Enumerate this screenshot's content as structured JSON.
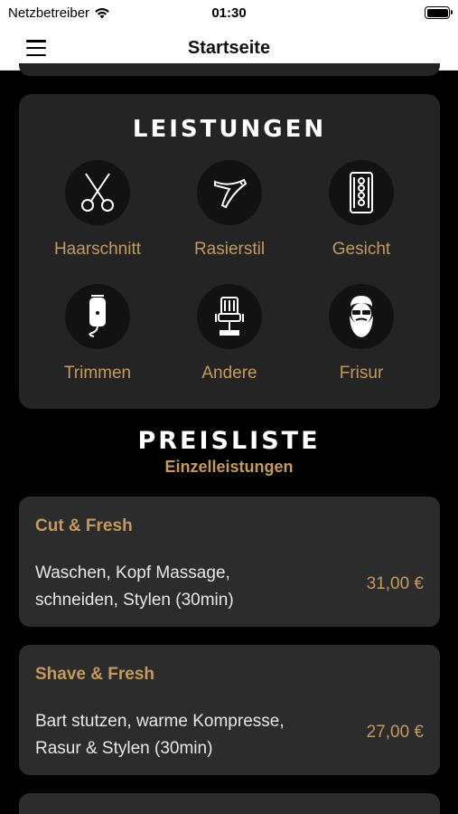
{
  "status_bar": {
    "carrier": "Netzbetreiber",
    "time": "01:30"
  },
  "nav": {
    "title": "Startseite"
  },
  "services": {
    "title": "LEISTUNGEN",
    "items": [
      {
        "label": "Haarschnitt",
        "icon": "scissors-icon"
      },
      {
        "label": "Rasierstil",
        "icon": "straight-razor-icon"
      },
      {
        "label": "Gesicht",
        "icon": "razor-blade-icon"
      },
      {
        "label": "Trimmen",
        "icon": "hair-clipper-icon"
      },
      {
        "label": "Andere",
        "icon": "barber-chair-icon"
      },
      {
        "label": "Frisur",
        "icon": "bearded-man-icon"
      }
    ]
  },
  "pricelist": {
    "title": "PREISLISTE",
    "subtitle": "Einzelleistungen",
    "items": [
      {
        "name": "Cut & Fresh",
        "desc_line1": "Waschen, Kopf Massage,",
        "desc_line2": "schneiden, Stylen (30min)",
        "price": "31,00 €"
      },
      {
        "name": "Shave & Fresh",
        "desc_line1": "Bart stutzen, warme Kompresse,",
        "desc_line2": "Rasur & Stylen (30min)",
        "price": "27,00 €"
      }
    ]
  },
  "colors": {
    "accent": "#c49a5e",
    "card": "#242424",
    "background": "#000000"
  }
}
